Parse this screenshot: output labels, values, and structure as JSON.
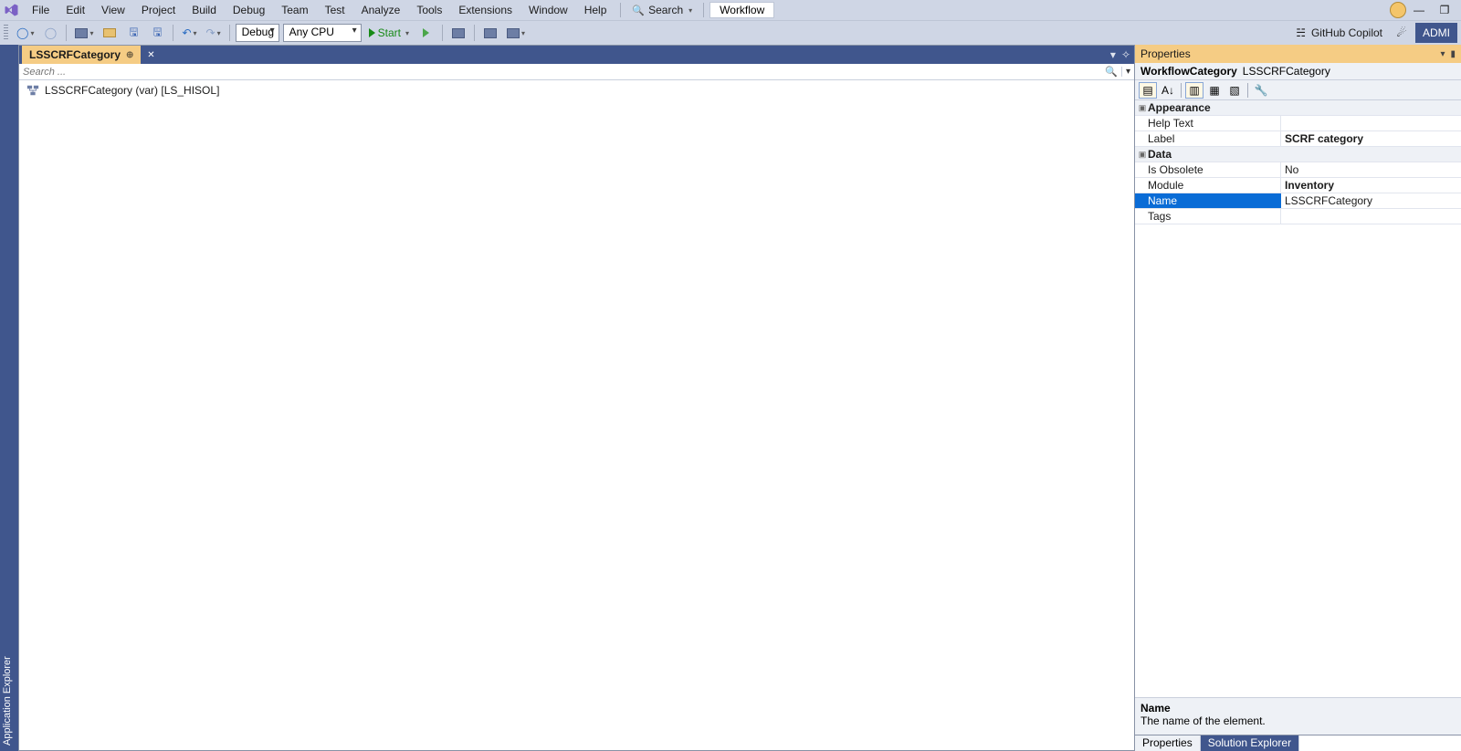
{
  "menubar": {
    "items": [
      "File",
      "Edit",
      "View",
      "Project",
      "Build",
      "Debug",
      "Team",
      "Test",
      "Analyze",
      "Tools",
      "Extensions",
      "Window",
      "Help"
    ],
    "search_label": "Search",
    "active_window": "Workflow"
  },
  "window_buttons": {
    "minimize": "—",
    "restore": "❐"
  },
  "toolbar": {
    "config": "Debug",
    "platform": "Any CPU",
    "start_label": "Start",
    "copilot_label": "GitHub Copilot",
    "admin_label": "ADMI"
  },
  "side_tab": "Application Explorer",
  "document": {
    "tab_title": "LSSCRFCategory",
    "search_placeholder": "Search ...",
    "tree_item": "LSSCRFCategory (var) [LS_HISOL]"
  },
  "properties": {
    "title": "Properties",
    "object_type": "WorkflowCategory",
    "object_name": "LSSCRFCategory",
    "groups": [
      {
        "name": "Appearance",
        "rows": [
          {
            "k": "Help Text",
            "v": "",
            "bold": false,
            "sel": false
          },
          {
            "k": "Label",
            "v": "SCRF category",
            "bold": true,
            "sel": false
          }
        ]
      },
      {
        "name": "Data",
        "rows": [
          {
            "k": "Is Obsolete",
            "v": "No",
            "bold": false,
            "sel": false
          },
          {
            "k": "Module",
            "v": "Inventory",
            "bold": true,
            "sel": false
          },
          {
            "k": "Name",
            "v": "LSSCRFCategory",
            "bold": false,
            "sel": true
          },
          {
            "k": "Tags",
            "v": "",
            "bold": false,
            "sel": false
          }
        ]
      }
    ],
    "description_name": "Name",
    "description_text": "The name of the element.",
    "bottom_tabs": [
      "Properties",
      "Solution Explorer"
    ]
  }
}
